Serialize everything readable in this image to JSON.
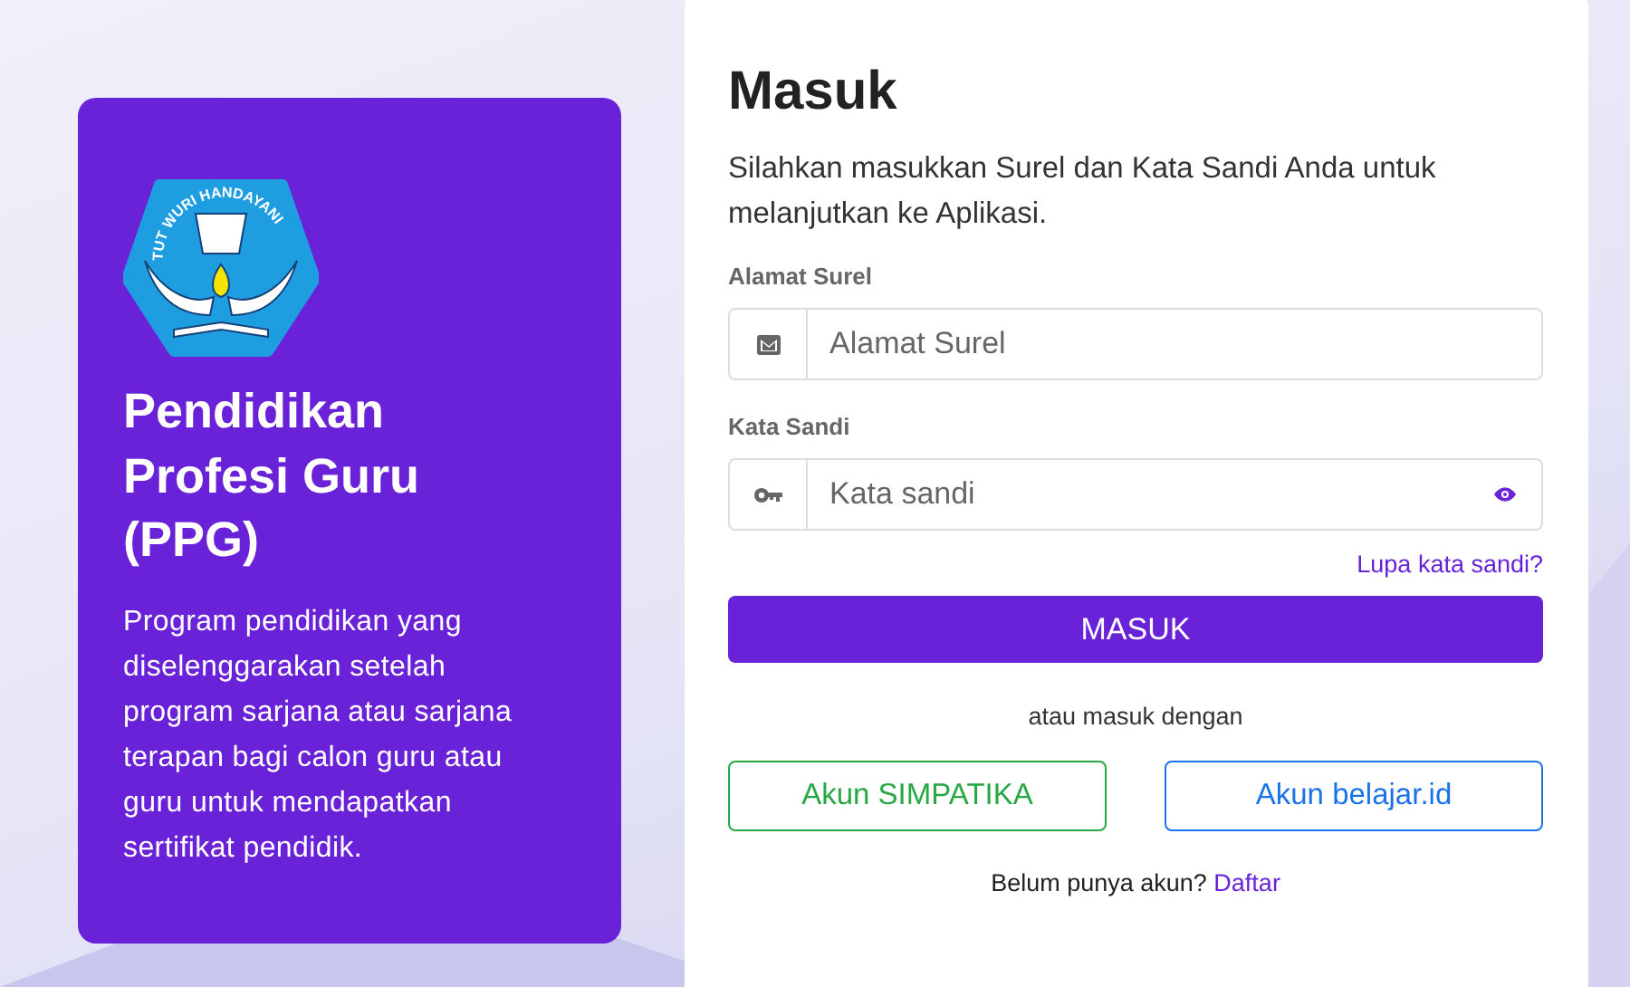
{
  "info_card": {
    "logo_text": "TUT WURI HANDAYANI",
    "title": "Pendidikan Profesi Guru (PPG)",
    "description": "Program pendidikan yang diselenggarakan setelah program sarjana atau sarjana terapan bagi calon guru atau guru untuk mendapatkan sertifikat pendidik."
  },
  "login": {
    "title": "Masuk",
    "subtitle": "Silahkan masukkan Surel dan Kata Sandi Anda untuk melanjutkan ke Aplikasi.",
    "fields": [
      {
        "label": "Alamat Surel",
        "placeholder": "Alamat Surel",
        "kind": "email"
      },
      {
        "label": "Kata Sandi",
        "placeholder": "Kata sandi",
        "kind": "password"
      }
    ],
    "forgot_link": "Lupa kata sandi?",
    "submit": "MASUK",
    "alt_text": "atau masuk dengan",
    "alt_buttons": [
      {
        "label": "Akun SIMPATIKA",
        "color": "#28a745"
      },
      {
        "label": "Akun belajar.id",
        "color": "#1a73e8"
      }
    ],
    "register_prompt": "Belum punya akun?",
    "register_link": "Daftar"
  }
}
